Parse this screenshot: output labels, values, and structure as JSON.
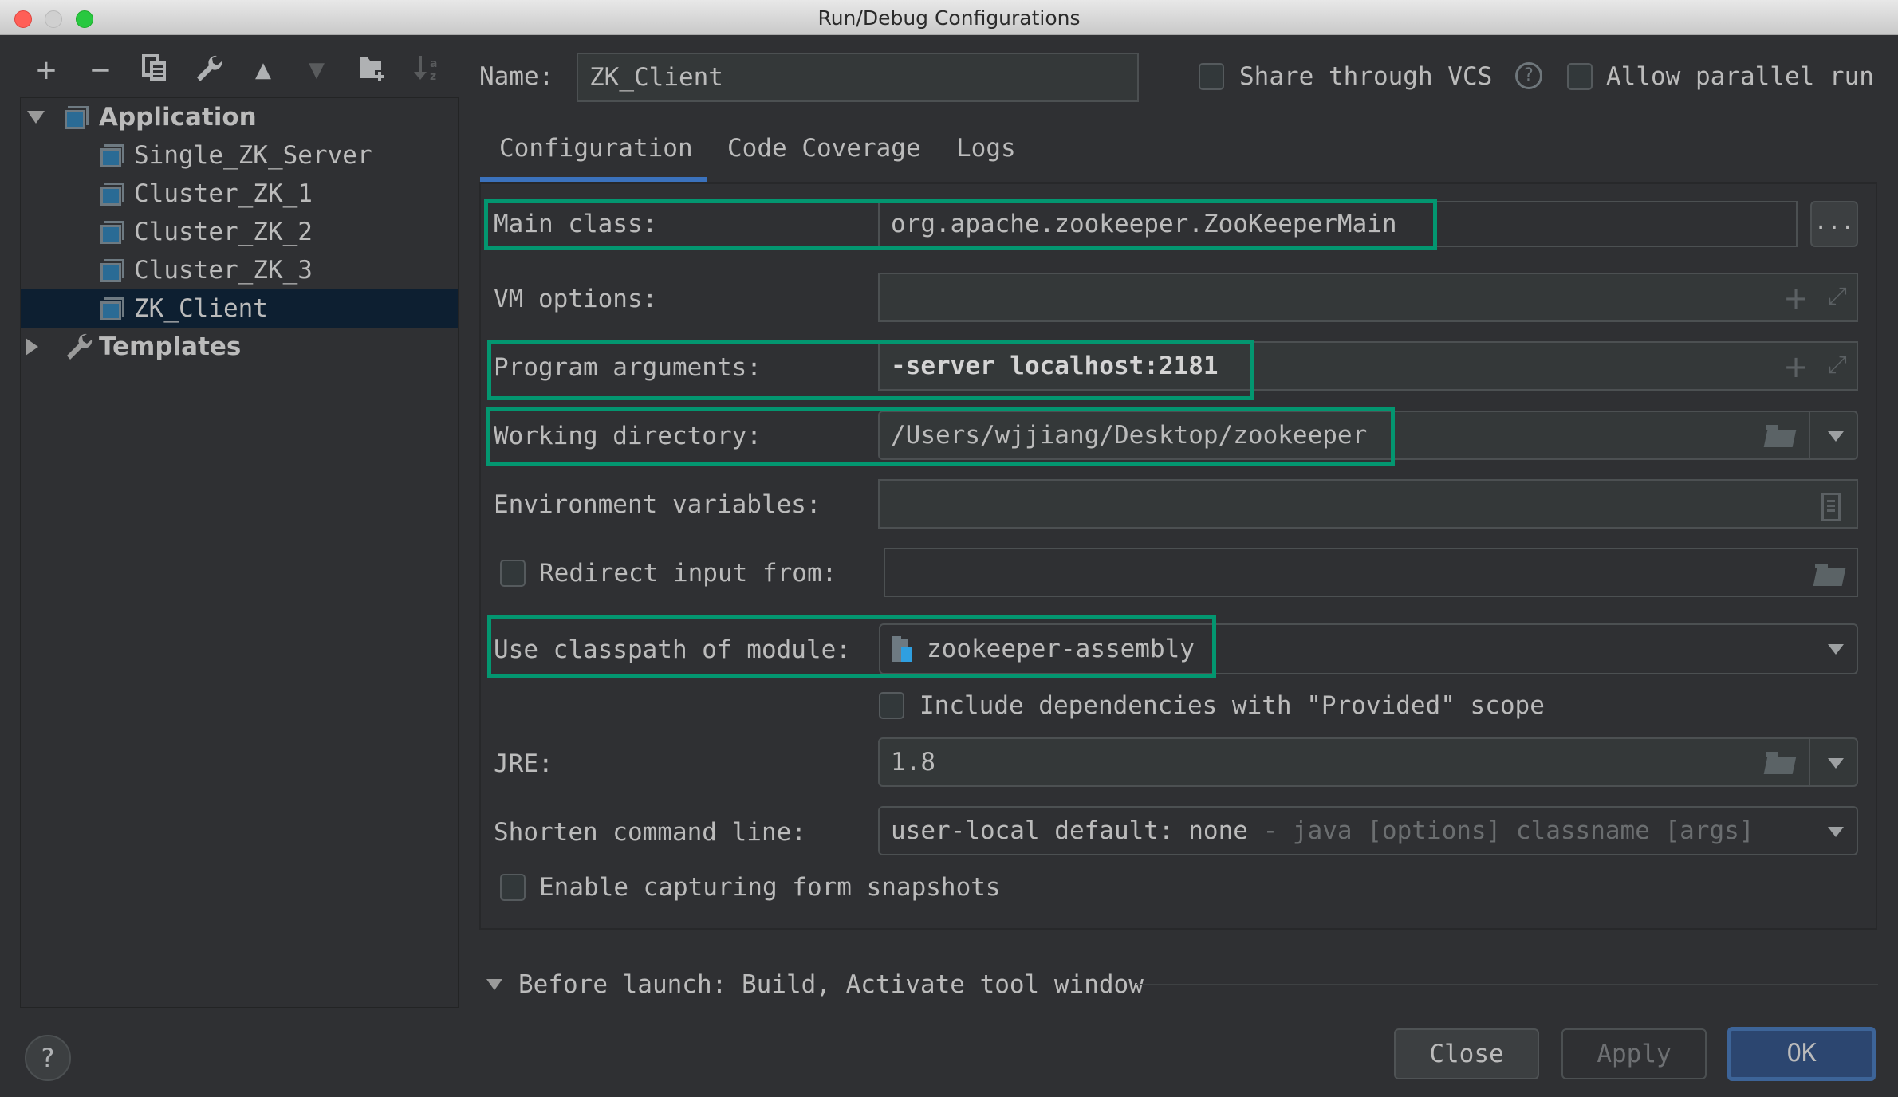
{
  "window": {
    "title": "Run/Debug Configurations",
    "traffic_lights": {
      "close": "#ff5f57",
      "minimize": "#d0d0d0",
      "zoom": "#28c840"
    }
  },
  "toolbar": {
    "icons": [
      {
        "name": "add-icon",
        "glyph": "+",
        "enabled": true
      },
      {
        "name": "remove-icon",
        "glyph": "−",
        "enabled": true
      },
      {
        "name": "copy-icon",
        "glyph": "⧉",
        "enabled": true
      },
      {
        "name": "wrench-icon",
        "glyph": "🔧",
        "enabled": true
      },
      {
        "name": "move-up-icon",
        "glyph": "▲",
        "enabled": true
      },
      {
        "name": "move-down-icon",
        "glyph": "▼",
        "enabled": false
      },
      {
        "name": "new-folder-icon",
        "glyph": "📁",
        "enabled": true
      },
      {
        "name": "sort-icon",
        "glyph": "↓ᵃᶻ",
        "enabled": false
      }
    ]
  },
  "tree": {
    "groups": [
      {
        "label": "Application",
        "expanded": true,
        "children": [
          "Single_ZK_Server",
          "Cluster_ZK_1",
          "Cluster_ZK_2",
          "Cluster_ZK_3",
          "ZK_Client"
        ],
        "selected": "ZK_Client"
      },
      {
        "label": "Templates",
        "expanded": false
      }
    ]
  },
  "header": {
    "name_label": "Name:",
    "name_value": "ZK_Client",
    "share_vcs_label": "Share through VCS",
    "share_vcs_checked": false,
    "help_glyph": "?",
    "parallel_label": "Allow parallel run",
    "parallel_checked": false
  },
  "tabs": [
    {
      "label": "Configuration",
      "active": true
    },
    {
      "label": "Code Coverage",
      "active": false
    },
    {
      "label": "Logs",
      "active": false
    }
  ],
  "form": {
    "main_class": {
      "label": "Main class:",
      "value": "org.apache.zookeeper.ZooKeeperMain",
      "browse_label": "..."
    },
    "vm_options": {
      "label": "VM options:",
      "value": ""
    },
    "program_arguments": {
      "label": "Program arguments:",
      "value": "-server localhost:2181"
    },
    "working_directory": {
      "label": "Working directory:",
      "value": "/Users/wjjiang/Desktop/zookeeper"
    },
    "environment_variables": {
      "label": "Environment variables:",
      "value": ""
    },
    "redirect_input": {
      "label": "Redirect input from:",
      "checked": false,
      "value": ""
    },
    "classpath_module": {
      "label": "Use classpath of module:",
      "value": "zookeeper-assembly"
    },
    "include_provided": {
      "label": "Include dependencies with \"Provided\" scope",
      "checked": false
    },
    "jre": {
      "label": "JRE:",
      "value": "1.8"
    },
    "shorten_command_line": {
      "label": "Shorten command line:",
      "value": "user-local default: none",
      "hint": " - java [options] classname [args]"
    },
    "form_snapshots": {
      "label": "Enable capturing form snapshots",
      "checked": false
    }
  },
  "before_launch": {
    "label": "Before launch: Build, Activate tool window"
  },
  "highlight_color": "#039670",
  "footer": {
    "help_glyph": "?",
    "close_label": "Close",
    "apply_label": "Apply",
    "ok_label": "OK",
    "apply_enabled": false
  }
}
